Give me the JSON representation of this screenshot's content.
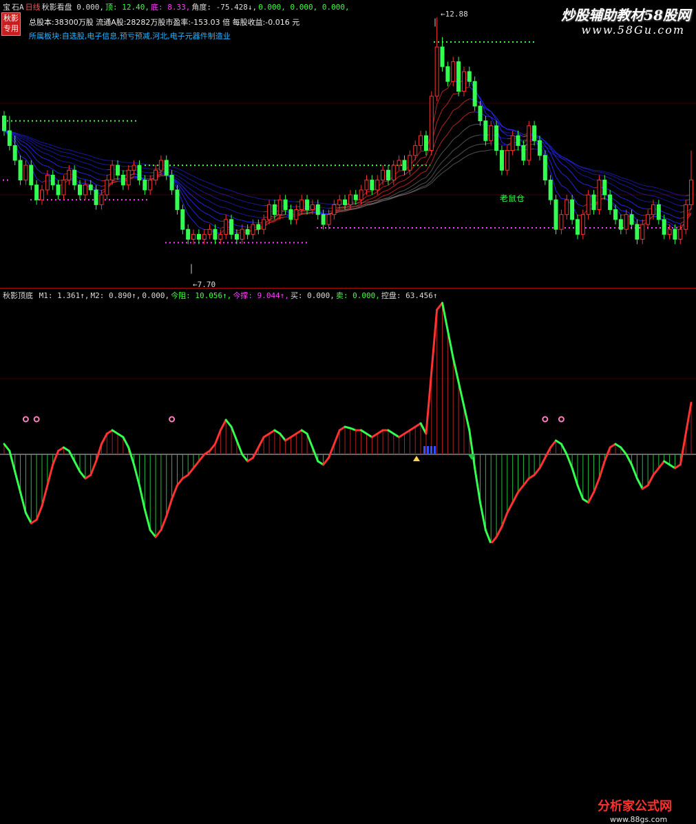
{
  "top_bar": {
    "items": [
      {
        "text": "宝",
        "color": "#dcdcdc"
      },
      {
        "text": "石A",
        "color": "#dcdcdc"
      },
      {
        "text": "日线",
        "color": "#ff5050"
      },
      {
        "text": "秋影看盘 0.000,",
        "color": "#dcdcdc"
      },
      {
        "text": "顶: 12.40,",
        "color": "#40ff40"
      },
      {
        "text": "底: 8.33,",
        "color": "#ff40ff"
      },
      {
        "text": "角度: -75.428↓,",
        "color": "#dcdcdc"
      },
      {
        "text": "0.000, 0.000, 0.000,",
        "color": "#40ff40"
      }
    ]
  },
  "badge": {
    "line1": "秋影",
    "line2": "专用"
  },
  "info": {
    "line1": "总股本:38300万股 流通A股:28282万股市盈率:-153.03 倍   每股收益:-0.016 元",
    "line2": "所属板块:自选股,电子信息,预亏预减,河北,电子元器件制造业"
  },
  "annotations": {
    "high_price": "12.88",
    "low_price": "7.70",
    "label_cangku": "老鼠仓"
  },
  "indicator_header": {
    "name": "秋影顶底",
    "items": [
      {
        "text": "M1: 1.361↑,",
        "color": "#dcdcdc"
      },
      {
        "text": "M2: 0.890↑,",
        "color": "#dcdcdc"
      },
      {
        "text": "0.000,",
        "color": "#dcdcdc"
      },
      {
        "text": "今阻: 10.056↑,",
        "color": "#40ff40"
      },
      {
        "text": "今撑: 9.044↑,",
        "color": "#ff40ff"
      },
      {
        "text": "买: 0.000,",
        "color": "#dcdcdc"
      },
      {
        "text": "卖: 0.000,",
        "color": "#40ff40"
      },
      {
        "text": "控盘: 63.456↑",
        "color": "#dcdcdc"
      }
    ]
  },
  "watermarks": {
    "top_title": "炒股辅助教材58股网",
    "top_url": "www.58Gu.com",
    "bottom_title": "分析家公式网",
    "bottom_url": "www.88gs.com"
  },
  "colors": {
    "up": "#ff3232",
    "down": "#32ff50",
    "ma_blue": "#2828ff",
    "support": "#ff40ff",
    "resist": "#40ff40",
    "separator": "#8b0000"
  },
  "chart_data": {
    "type": "candlestick",
    "price_range": [
      7.5,
      13.0
    ],
    "high_annotation": 12.88,
    "low_annotation": 7.7,
    "resistance": 12.4,
    "support": 8.33,
    "candles": [
      [
        10.9,
        10.6,
        11.0,
        10.5
      ],
      [
        10.6,
        10.3,
        10.9,
        10.2
      ],
      [
        10.3,
        10.0,
        10.5,
        9.9
      ],
      [
        10.0,
        9.6,
        10.1,
        9.5
      ],
      [
        9.6,
        9.9,
        10.0,
        9.5
      ],
      [
        9.9,
        9.5,
        10.0,
        9.4
      ],
      [
        9.5,
        9.2,
        9.6,
        9.1
      ],
      [
        9.2,
        9.4,
        9.5,
        9.1
      ],
      [
        9.4,
        9.7,
        9.8,
        9.3
      ],
      [
        9.7,
        9.5,
        9.8,
        9.4
      ],
      [
        9.5,
        9.3,
        9.6,
        9.2
      ],
      [
        9.3,
        9.6,
        9.7,
        9.2
      ],
      [
        9.6,
        9.8,
        9.9,
        9.5
      ],
      [
        9.8,
        9.5,
        9.9,
        9.4
      ],
      [
        9.5,
        9.3,
        9.6,
        9.2
      ],
      [
        9.3,
        9.5,
        9.6,
        9.2
      ],
      [
        9.5,
        9.4,
        9.6,
        9.3
      ],
      [
        9.4,
        9.1,
        9.5,
        9.0
      ],
      [
        9.1,
        9.3,
        9.4,
        9.0
      ],
      [
        9.3,
        9.6,
        9.7,
        9.2
      ],
      [
        9.6,
        9.9,
        10.0,
        9.5
      ],
      [
        9.9,
        9.7,
        10.0,
        9.6
      ],
      [
        9.7,
        9.5,
        9.8,
        9.4
      ],
      [
        9.5,
        9.8,
        9.9,
        9.4
      ],
      [
        9.8,
        9.9,
        10.0,
        9.7
      ],
      [
        9.9,
        9.6,
        10.0,
        9.5
      ],
      [
        9.6,
        9.4,
        9.7,
        9.3
      ],
      [
        9.4,
        9.6,
        9.7,
        9.3
      ],
      [
        9.6,
        9.8,
        9.9,
        9.5
      ],
      [
        9.8,
        10.0,
        10.1,
        9.7
      ],
      [
        10.0,
        9.7,
        10.1,
        9.6
      ],
      [
        9.7,
        9.4,
        9.8,
        9.3
      ],
      [
        9.4,
        9.0,
        9.5,
        8.9
      ],
      [
        9.0,
        8.6,
        9.1,
        8.5
      ],
      [
        8.6,
        8.4,
        8.7,
        8.3
      ],
      [
        8.4,
        8.5,
        8.6,
        8.3
      ],
      [
        8.5,
        8.4,
        8.6,
        8.3
      ],
      [
        8.4,
        8.5,
        8.6,
        8.3
      ],
      [
        8.5,
        8.6,
        8.7,
        8.4
      ],
      [
        8.6,
        8.4,
        8.7,
        8.3
      ],
      [
        8.4,
        8.5,
        8.6,
        8.3
      ],
      [
        8.5,
        8.8,
        8.9,
        8.4
      ],
      [
        8.8,
        8.5,
        8.9,
        8.4
      ],
      [
        8.5,
        8.4,
        8.6,
        8.3
      ],
      [
        8.4,
        8.6,
        8.7,
        8.3
      ],
      [
        8.6,
        8.5,
        8.7,
        8.4
      ],
      [
        8.5,
        8.7,
        8.8,
        8.4
      ],
      [
        8.7,
        8.6,
        8.8,
        8.5
      ],
      [
        8.6,
        8.8,
        8.9,
        8.5
      ],
      [
        8.8,
        9.1,
        9.2,
        8.7
      ],
      [
        9.1,
        8.9,
        9.2,
        8.8
      ],
      [
        8.9,
        9.2,
        9.3,
        8.8
      ],
      [
        9.2,
        9.0,
        9.3,
        8.9
      ],
      [
        9.0,
        8.8,
        9.1,
        8.7
      ],
      [
        8.8,
        9.0,
        9.1,
        8.7
      ],
      [
        9.0,
        9.2,
        9.3,
        8.9
      ],
      [
        9.2,
        9.0,
        9.3,
        8.9
      ],
      [
        9.0,
        9.1,
        9.2,
        8.9
      ],
      [
        9.1,
        8.9,
        9.2,
        8.8
      ],
      [
        8.9,
        8.7,
        9.0,
        8.6
      ],
      [
        8.7,
        8.9,
        9.0,
        8.6
      ],
      [
        8.9,
        9.1,
        9.2,
        8.8
      ],
      [
        9.1,
        9.2,
        9.3,
        9.0
      ],
      [
        9.2,
        9.1,
        9.3,
        9.0
      ],
      [
        9.1,
        9.3,
        9.4,
        9.0
      ],
      [
        9.3,
        9.2,
        9.4,
        9.1
      ],
      [
        9.2,
        9.4,
        9.5,
        9.1
      ],
      [
        9.4,
        9.6,
        9.7,
        9.3
      ],
      [
        9.6,
        9.4,
        9.7,
        9.3
      ],
      [
        9.4,
        9.6,
        9.7,
        9.3
      ],
      [
        9.6,
        9.8,
        9.9,
        9.5
      ],
      [
        9.8,
        9.6,
        9.9,
        9.5
      ],
      [
        9.6,
        9.9,
        10.0,
        9.5
      ],
      [
        9.9,
        10.0,
        10.1,
        9.8
      ],
      [
        10.0,
        9.8,
        10.1,
        9.7
      ],
      [
        9.8,
        10.1,
        10.2,
        9.7
      ],
      [
        10.1,
        10.3,
        10.4,
        10.0
      ],
      [
        10.3,
        10.5,
        10.6,
        10.2
      ],
      [
        10.5,
        10.2,
        10.6,
        10.1
      ],
      [
        10.2,
        11.3,
        11.4,
        10.1
      ],
      [
        11.3,
        12.3,
        12.9,
        11.2
      ],
      [
        12.3,
        11.9,
        12.5,
        11.8
      ],
      [
        11.9,
        11.6,
        12.0,
        11.5
      ],
      [
        11.6,
        12.0,
        12.1,
        11.5
      ],
      [
        12.0,
        11.4,
        12.1,
        11.3
      ],
      [
        11.4,
        11.8,
        11.9,
        11.3
      ],
      [
        11.8,
        11.6,
        11.9,
        11.5
      ],
      [
        11.6,
        11.1,
        11.7,
        11.0
      ],
      [
        11.1,
        10.8,
        11.2,
        10.7
      ],
      [
        10.8,
        10.4,
        10.9,
        10.3
      ],
      [
        10.4,
        10.7,
        10.8,
        10.3
      ],
      [
        10.7,
        10.2,
        10.8,
        10.1
      ],
      [
        10.2,
        9.8,
        10.3,
        9.7
      ],
      [
        9.8,
        10.2,
        10.3,
        9.7
      ],
      [
        10.2,
        10.5,
        10.6,
        10.1
      ],
      [
        10.5,
        10.3,
        10.6,
        10.2
      ],
      [
        10.3,
        10.0,
        10.4,
        9.9
      ],
      [
        10.0,
        10.7,
        10.8,
        9.9
      ],
      [
        10.7,
        10.4,
        10.8,
        10.3
      ],
      [
        10.4,
        10.1,
        10.5,
        10.0
      ],
      [
        10.1,
        9.6,
        10.2,
        9.5
      ],
      [
        9.6,
        9.2,
        9.7,
        9.1
      ],
      [
        9.2,
        8.6,
        9.3,
        8.5
      ],
      [
        8.6,
        8.9,
        9.0,
        8.5
      ],
      [
        8.9,
        9.2,
        9.3,
        8.8
      ],
      [
        9.2,
        8.8,
        9.3,
        8.7
      ],
      [
        8.8,
        8.5,
        8.9,
        8.4
      ],
      [
        8.5,
        8.9,
        9.0,
        8.4
      ],
      [
        8.9,
        9.3,
        9.4,
        8.8
      ],
      [
        9.3,
        9.0,
        9.4,
        8.9
      ],
      [
        9.0,
        9.6,
        9.7,
        8.9
      ],
      [
        9.6,
        9.3,
        9.7,
        9.2
      ],
      [
        9.3,
        9.0,
        9.4,
        8.9
      ],
      [
        9.0,
        8.8,
        9.1,
        8.7
      ],
      [
        8.8,
        8.6,
        8.9,
        8.5
      ],
      [
        8.6,
        8.9,
        9.0,
        8.5
      ],
      [
        8.9,
        8.7,
        9.0,
        8.6
      ],
      [
        8.7,
        8.4,
        8.8,
        8.3
      ],
      [
        8.4,
        8.7,
        8.8,
        8.3
      ],
      [
        8.7,
        8.9,
        9.0,
        8.6
      ],
      [
        8.9,
        9.1,
        9.2,
        8.8
      ],
      [
        9.1,
        8.8,
        9.2,
        8.7
      ],
      [
        8.8,
        8.5,
        8.9,
        8.4
      ],
      [
        8.5,
        8.6,
        8.7,
        8.4
      ],
      [
        8.6,
        8.4,
        8.7,
        8.3
      ],
      [
        8.4,
        8.6,
        8.7,
        8.3
      ],
      [
        8.6,
        9.1,
        9.2,
        8.5
      ],
      [
        9.1,
        9.6,
        10.2,
        9.0
      ]
    ],
    "oscillator": [
      0.15,
      0.05,
      -0.25,
      -0.55,
      -0.85,
      -1.0,
      -0.95,
      -0.75,
      -0.45,
      -0.15,
      0.05,
      0.1,
      0.05,
      -0.1,
      -0.25,
      -0.35,
      -0.3,
      -0.1,
      0.15,
      0.3,
      0.35,
      0.3,
      0.25,
      0.1,
      -0.15,
      -0.45,
      -0.8,
      -1.1,
      -1.2,
      -1.1,
      -0.9,
      -0.65,
      -0.45,
      -0.35,
      -0.3,
      -0.2,
      -0.1,
      0.0,
      0.05,
      0.15,
      0.35,
      0.5,
      0.4,
      0.2,
      0.0,
      -0.1,
      -0.05,
      0.1,
      0.25,
      0.3,
      0.35,
      0.3,
      0.2,
      0.25,
      0.3,
      0.35,
      0.3,
      0.1,
      -0.1,
      -0.15,
      -0.05,
      0.15,
      0.35,
      0.4,
      0.38,
      0.35,
      0.35,
      0.3,
      0.25,
      0.3,
      0.35,
      0.35,
      0.3,
      0.25,
      0.3,
      0.35,
      0.4,
      0.45,
      0.3,
      1.2,
      2.1,
      2.2,
      1.8,
      1.4,
      1.05,
      0.7,
      0.35,
      -0.2,
      -0.7,
      -1.1,
      -1.3,
      -1.2,
      -1.05,
      -0.85,
      -0.7,
      -0.55,
      -0.45,
      -0.35,
      -0.3,
      -0.2,
      -0.05,
      0.1,
      0.2,
      0.15,
      0.0,
      -0.2,
      -0.45,
      -0.65,
      -0.7,
      -0.55,
      -0.35,
      -0.1,
      0.1,
      0.15,
      0.1,
      0.0,
      -0.15,
      -0.35,
      -0.5,
      -0.45,
      -0.3,
      -0.2,
      -0.1,
      -0.15,
      -0.2,
      -0.15,
      0.3,
      0.75
    ],
    "pink_markers_index": [
      4,
      6,
      31,
      100,
      103
    ]
  }
}
